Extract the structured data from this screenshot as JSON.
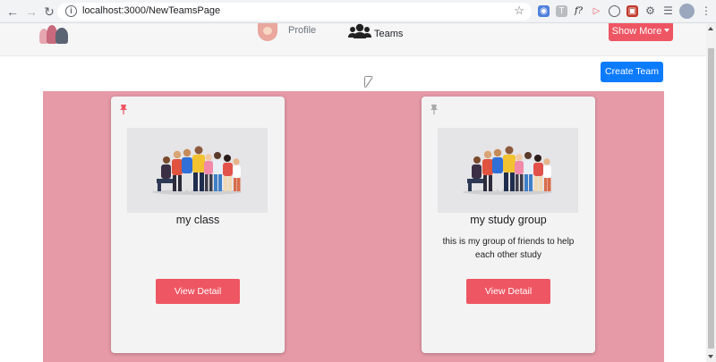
{
  "browser": {
    "url": "localhost:3000/NewTeamsPage",
    "back_icon": "back-arrow-icon",
    "forward_icon": "forward-arrow-icon",
    "reload_icon": "reload-icon",
    "extension_f": "f?"
  },
  "navbar": {
    "profile_label": "Profile",
    "teams_label": "Teams",
    "show_more_label": "Show More",
    "accent": "#ef5663"
  },
  "actions": {
    "create_team_label": "Create Team",
    "create_team_color": "#0d7bfd"
  },
  "teams": [
    {
      "name": "my class",
      "description": "",
      "pinned": true,
      "pin_color": "#ef5663",
      "detail_label": "View Detail"
    },
    {
      "name": "my study group",
      "description": "this is my group of friends to help each other study",
      "pinned": false,
      "pin_color": "#a8a8a8",
      "detail_label": "View Detail"
    }
  ],
  "colors": {
    "teams_background": "#e69aa7",
    "card_background": "#f3f3f4"
  }
}
